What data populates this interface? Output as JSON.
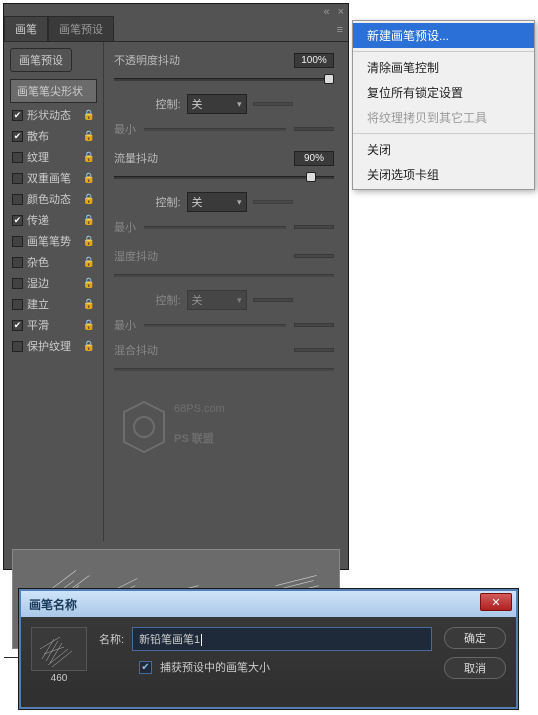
{
  "tabs": [
    "画笔",
    "画笔预设"
  ],
  "preset_btn": "画笔预设",
  "sidebar": {
    "head": "画笔笔尖形状",
    "items": [
      {
        "label": "形状动态",
        "checked": true
      },
      {
        "label": "散布",
        "checked": true
      },
      {
        "label": "纹理",
        "checked": false
      },
      {
        "label": "双重画笔",
        "checked": false
      },
      {
        "label": "颜色动态",
        "checked": false
      },
      {
        "label": "传递",
        "checked": true
      },
      {
        "label": "画笔笔势",
        "checked": false
      },
      {
        "label": "杂色",
        "checked": false
      },
      {
        "label": "湿边",
        "checked": false
      },
      {
        "label": "建立",
        "checked": false
      },
      {
        "label": "平滑",
        "checked": true
      },
      {
        "label": "保护纹理",
        "checked": false
      }
    ]
  },
  "content": {
    "opacity_jitter": "不透明度抖动",
    "opacity_val": "100%",
    "control": "控制:",
    "control_val": "关",
    "min": "最小",
    "flow_jitter": "流量抖动",
    "flow_val": "90%",
    "wetness": "湿度抖动",
    "mix": "混合抖动"
  },
  "watermark": {
    "line1": "68PS.com",
    "line2": "PS 联盟"
  },
  "menu": {
    "new_preset": "新建画笔预设...",
    "clear": "清除画笔控制",
    "reset_locked": "复位所有锁定设置",
    "copy_tex": "将纹理拷贝到其它工具",
    "close": "关闭",
    "close_group": "关闭选项卡组"
  },
  "dialog": {
    "title": "画笔名称",
    "name_label": "名称:",
    "name_value": "新铅笔画笔1",
    "capture": "捕获预设中的画笔大小",
    "ok": "确定",
    "cancel": "取消",
    "thumb_caption": "460"
  }
}
